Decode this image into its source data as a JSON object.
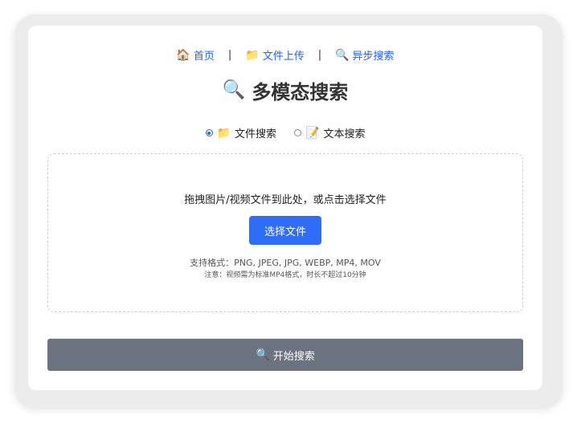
{
  "nav": {
    "items": [
      {
        "icon": "house-icon",
        "glyph": "🏠",
        "label": "首页"
      },
      {
        "icon": "folder-icon",
        "glyph": "📁",
        "label": "文件上传"
      },
      {
        "icon": "search-icon",
        "glyph": "🔍",
        "label": "异步搜索"
      }
    ],
    "separator": "|"
  },
  "page": {
    "title_icon": "🔍",
    "title": "多模态搜索"
  },
  "modes": {
    "selected": "file",
    "file": {
      "icon": "📁",
      "label": "文件搜索"
    },
    "text": {
      "icon": "📝",
      "label": "文本搜索"
    }
  },
  "upload": {
    "prompt": "拖拽图片/视频文件到此处，或点击选择文件",
    "choose_label": "选择文件",
    "formats": "支持格式：PNG, JPEG, JPG, WEBP, MP4, MOV",
    "note": "注意：视频需为标准MP4格式，时长不超过10分钟"
  },
  "search": {
    "icon": "🔍",
    "label": "开始搜索"
  },
  "colors": {
    "accent": "#2f6df6",
    "link": "#2563eb",
    "search_button": "#6b7280",
    "background": "#ececec"
  }
}
